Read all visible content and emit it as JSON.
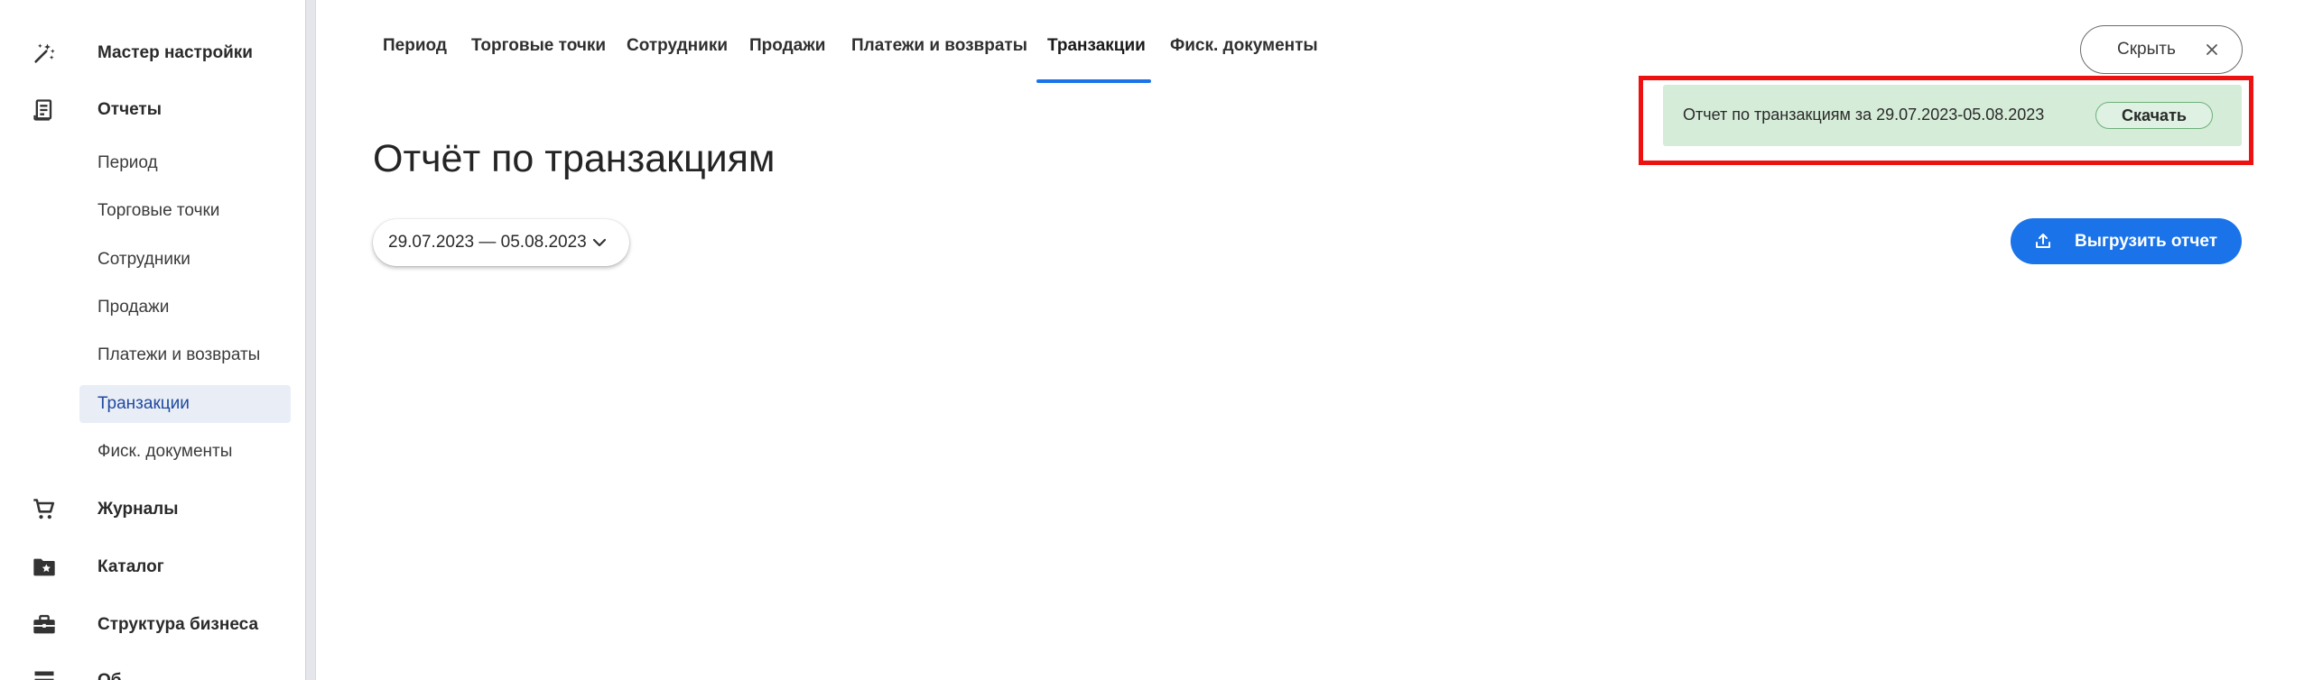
{
  "sidebar": {
    "items": [
      {
        "label": "Мастер настройки",
        "icon": "magic-wand-icon"
      },
      {
        "label": "Отчеты",
        "icon": "receipt-icon"
      },
      {
        "label": "Журналы",
        "icon": "cart-icon"
      },
      {
        "label": "Каталог",
        "icon": "folder-star-icon"
      },
      {
        "label": "Структура бизнеса",
        "icon": "briefcase-icon"
      },
      {
        "label": "Об",
        "icon": "list-icon"
      }
    ],
    "reports_subitems": [
      {
        "label": "Период"
      },
      {
        "label": "Торговые точки"
      },
      {
        "label": "Сотрудники"
      },
      {
        "label": "Продажи"
      },
      {
        "label": "Платежи и возвраты"
      },
      {
        "label": "Транзакции",
        "active": true
      },
      {
        "label": "Фиск. документы"
      }
    ]
  },
  "tabs": [
    {
      "label": "Период"
    },
    {
      "label": "Торговые точки"
    },
    {
      "label": "Сотрудники"
    },
    {
      "label": "Продажи"
    },
    {
      "label": "Платежи и возвраты"
    },
    {
      "label": "Транзакции",
      "active": true
    },
    {
      "label": "Фиск. документы"
    }
  ],
  "hide_button": {
    "label": "Скрыть"
  },
  "notification": {
    "text": "Отчет по транзакциям за 29.07.2023-05.08.2023",
    "download_label": "Скачать"
  },
  "page": {
    "title": "Отчёт по транзакциям",
    "date_range": "29.07.2023 — 05.08.2023",
    "export_label": "Выгрузить отчет"
  },
  "colors": {
    "accent": "#1a73e8",
    "notification_bg": "#d5ecd8",
    "highlight_border": "#ee1111",
    "active_subitem_bg": "#e9edf6"
  }
}
